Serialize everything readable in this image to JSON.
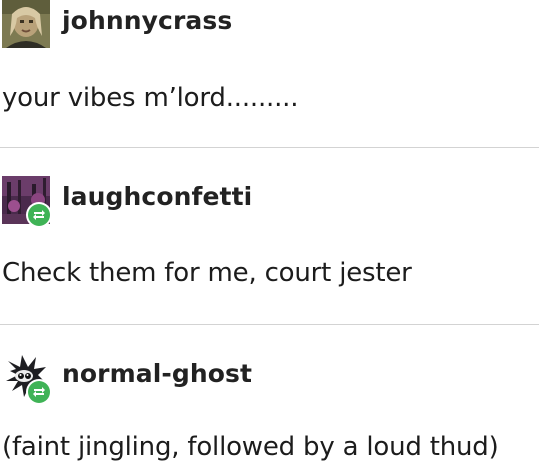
{
  "thread": {
    "posts": [
      {
        "username": "johnnycrass",
        "text": "your vibes m’lord.........",
        "avatar_icon": "portrait-avatar-icon",
        "reblogged": false
      },
      {
        "username": "laughconfetti",
        "text": "Check them for me, court jester",
        "avatar_icon": "purple-forest-avatar-icon",
        "reblogged": true
      },
      {
        "username": "normal-ghost",
        "text": "(faint jingling, followed by a loud thud)",
        "avatar_icon": "raccoon-avatar-icon",
        "reblogged": true
      }
    ]
  },
  "colors": {
    "reblog_badge": "#3fb356",
    "divider": "#d3d3d3",
    "text": "#1c1c1c"
  },
  "icons": {
    "reblog": "reblog-icon"
  }
}
